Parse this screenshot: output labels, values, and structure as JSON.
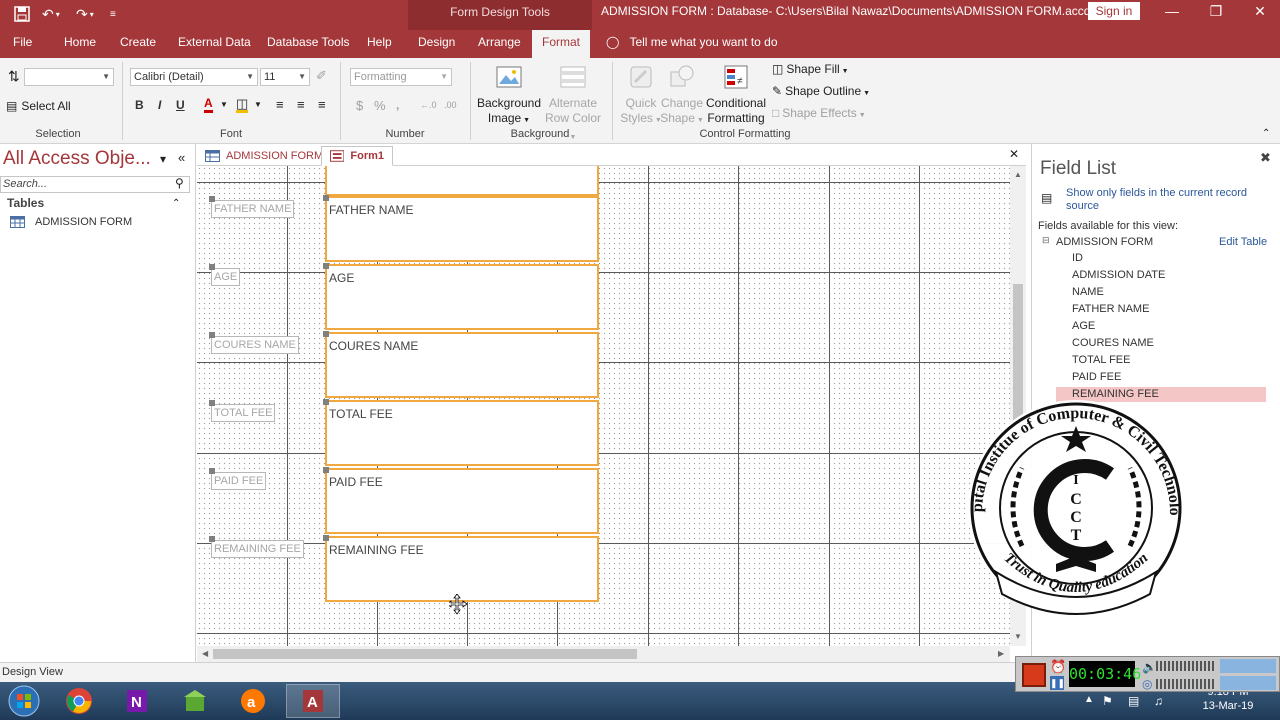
{
  "titlebar": {
    "context_tab": "Form Design Tools",
    "title": "ADMISSION FORM : Database- C:\\Users\\Bilal Nawaz\\Documents\\ADMISSION FORM.accdb (A...",
    "signin": "Sign in"
  },
  "tabs": [
    "File",
    "Home",
    "Create",
    "External Data",
    "Database Tools",
    "Help",
    "Design",
    "Arrange",
    "Format"
  ],
  "active_tab": "Format",
  "tellme": "Tell me what you want to do",
  "ribbon": {
    "selection": {
      "select_all": "Select All",
      "label": "Selection"
    },
    "font": {
      "name": "Calibri (Detail)",
      "size": "11",
      "label": "Font",
      "bold": "B",
      "italic": "I",
      "underline": "U",
      "font_color": "A"
    },
    "number": {
      "format": "Formatting",
      "label": "Number",
      "currency": "$",
      "percent": "%",
      "dec_inc": "←.0",
      "dec_dec": ".00"
    },
    "background": {
      "image": "Background Image",
      "alt_row": "Alternate Row Color",
      "label": "Background"
    },
    "control": {
      "quick_styles": "Quick Styles",
      "change_shape": "Change Shape",
      "conditional": "Conditional Formatting",
      "shape_fill": "Shape Fill",
      "shape_outline": "Shape Outline",
      "shape_effects": "Shape Effects",
      "label": "Control Formatting"
    }
  },
  "nav": {
    "title": "All Access Obje...",
    "search_placeholder": "Search...",
    "section": "Tables",
    "items": [
      "ADMISSION FORM"
    ]
  },
  "doc_tabs": [
    "ADMISSION FORM",
    "Form1"
  ],
  "form_rows": [
    {
      "label": "FATHER NAME",
      "textbox": "FATHER NAME"
    },
    {
      "label": "AGE",
      "textbox": "AGE"
    },
    {
      "label": "COURES NAME",
      "textbox": "COURES NAME"
    },
    {
      "label": "TOTAL FEE",
      "textbox": "TOTAL FEE"
    },
    {
      "label": "PAID FEE",
      "textbox": "PAID FEE"
    },
    {
      "label": "REMAINING FEE",
      "textbox": "REMAINING FEE"
    }
  ],
  "field_list": {
    "title": "Field List",
    "show_only": "Show only fields in the current record source",
    "available": "Fields available for this view:",
    "table": "ADMISSION FORM",
    "edit": "Edit Table",
    "fields": [
      "ID",
      "ADMISSION DATE",
      "NAME",
      "FATHER NAME",
      "AGE",
      "COURES NAME",
      "TOTAL FEE",
      "PAID FEE",
      "REMAINING FEE"
    ],
    "selected": "REMAINING FEE"
  },
  "status": "Design View",
  "recorder": {
    "time": "00:03:46"
  },
  "clock": {
    "time": "9:18 PM",
    "date": "13-Mar-19"
  },
  "seal": {
    "top_text": "Capital Institue of Computer & Civil Technology",
    "bottom_text": "Trust in Quality education",
    "letters": [
      "I",
      "C",
      "C",
      "T"
    ]
  },
  "colors": {
    "accent": "#a4373a",
    "selection": "#f0a840",
    "field_selected": "#f4c6c6"
  }
}
